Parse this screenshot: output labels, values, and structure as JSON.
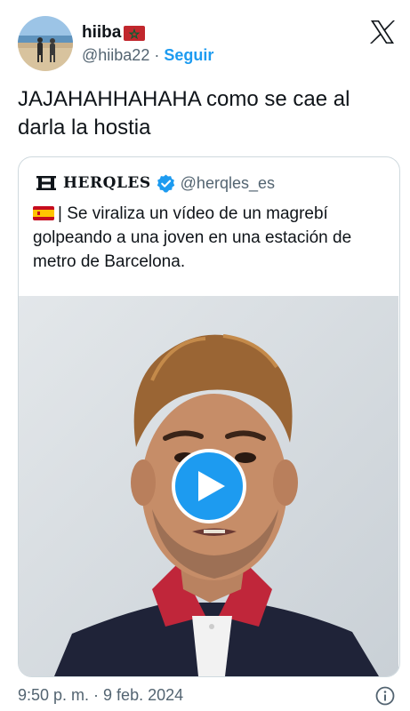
{
  "author": {
    "display_name": "hiiba",
    "flag_icon": "morocco-flag-icon",
    "handle": "@hiiba22",
    "separator": "·",
    "follow_label": "Seguir"
  },
  "tweet": {
    "text": "JAJAHAHHAHAHA como se cae al darla la hostia"
  },
  "quote": {
    "name": "HERQLES",
    "verified_icon": "verified-badge-icon",
    "handle": "@herqles_es",
    "flag_icon": "spain-flag-icon",
    "text": "| Se viraliza un vídeo de un magrebí golpeando a una joven en una estación de metro de Barcelona.",
    "media": {
      "type": "video",
      "play_icon": "play-icon"
    }
  },
  "footer": {
    "time": "9:50 p. m.",
    "separator": "·",
    "date": "9 feb. 2024",
    "info_icon": "info-icon"
  },
  "colors": {
    "accent": "#1d9bf0",
    "text_primary": "#0f1419",
    "text_secondary": "#536471",
    "border": "#cfd9de"
  }
}
